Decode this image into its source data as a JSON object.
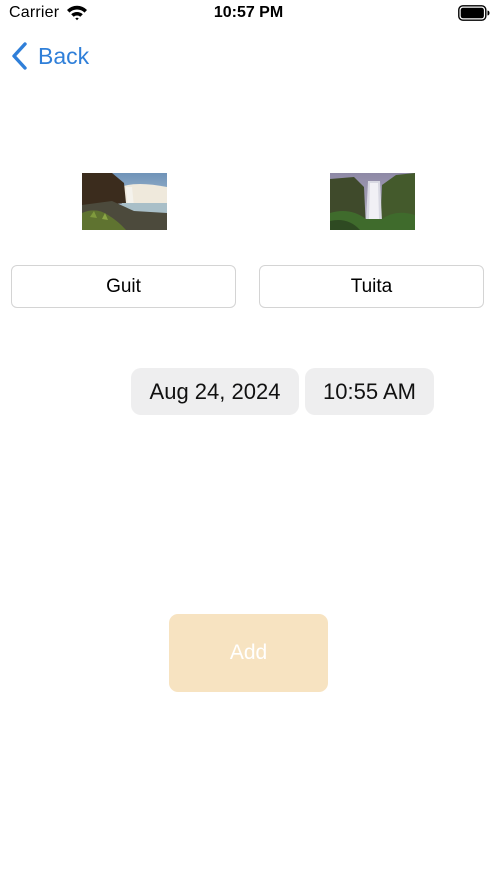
{
  "status_bar": {
    "carrier": "Carrier",
    "time": "10:57 PM",
    "icons": [
      "wifi-icon",
      "battery-icon"
    ]
  },
  "nav": {
    "back_label": "Back",
    "back_icon": "chevron-left-icon",
    "accent_color": "#2f7fd9"
  },
  "images": [
    {
      "subject": "waterfall beside a rocky coastline"
    },
    {
      "subject": "tall waterfall in a green canyon"
    }
  ],
  "fields": {
    "left_name": "Guit",
    "right_name": "Tuita"
  },
  "datetime": {
    "date": "Aug 24, 2024",
    "time": "10:55 AM"
  },
  "actions": {
    "add_label": "Add",
    "add_color": "#f7e3c1",
    "add_enabled": false
  }
}
